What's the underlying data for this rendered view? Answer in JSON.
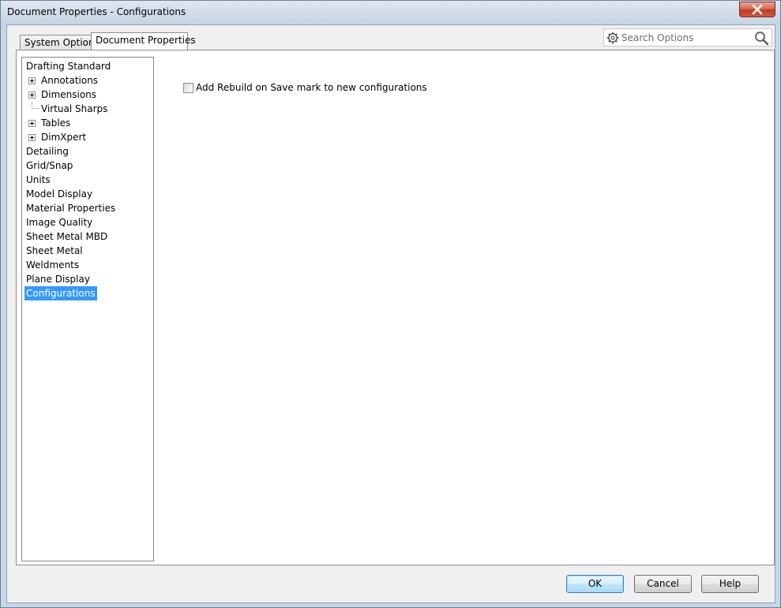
{
  "window": {
    "title": "Document Properties - Configurations"
  },
  "tabs": [
    {
      "label": "System Options",
      "active": false
    },
    {
      "label": "Document Properties",
      "active": true
    }
  ],
  "search": {
    "placeholder": "Search Options",
    "value": ""
  },
  "tree": {
    "items": [
      {
        "label": "Drafting Standard",
        "level": 0,
        "expandable": false
      },
      {
        "label": "Annotations",
        "level": 1,
        "expandable": true
      },
      {
        "label": "Dimensions",
        "level": 1,
        "expandable": true
      },
      {
        "label": "Virtual Sharps",
        "level": 1,
        "expandable": false
      },
      {
        "label": "Tables",
        "level": 1,
        "expandable": true
      },
      {
        "label": "DimXpert",
        "level": 1,
        "expandable": true
      },
      {
        "label": "Detailing",
        "level": 0,
        "expandable": false
      },
      {
        "label": "Grid/Snap",
        "level": 0,
        "expandable": false
      },
      {
        "label": "Units",
        "level": 0,
        "expandable": false
      },
      {
        "label": "Model Display",
        "level": 0,
        "expandable": false
      },
      {
        "label": "Material Properties",
        "level": 0,
        "expandable": false
      },
      {
        "label": "Image Quality",
        "level": 0,
        "expandable": false
      },
      {
        "label": "Sheet Metal MBD",
        "level": 0,
        "expandable": false
      },
      {
        "label": "Sheet Metal",
        "level": 0,
        "expandable": false
      },
      {
        "label": "Weldments",
        "level": 0,
        "expandable": false
      },
      {
        "label": "Plane Display",
        "level": 0,
        "expandable": false
      },
      {
        "label": "Configurations",
        "level": 0,
        "expandable": false,
        "selected": true
      }
    ]
  },
  "options": {
    "add_rebuild": {
      "label": "Add Rebuild on Save mark to new configurations",
      "checked": false
    }
  },
  "buttons": {
    "ok": "OK",
    "cancel": "Cancel",
    "help": "Help"
  },
  "colors": {
    "selection": "#3399ff",
    "close_button": "#c8432b",
    "title_bar": "#cfdbe8"
  },
  "icons": {
    "close": "close-icon",
    "gear": "gear-icon",
    "search": "search-icon",
    "expand": "plus-box-icon"
  }
}
